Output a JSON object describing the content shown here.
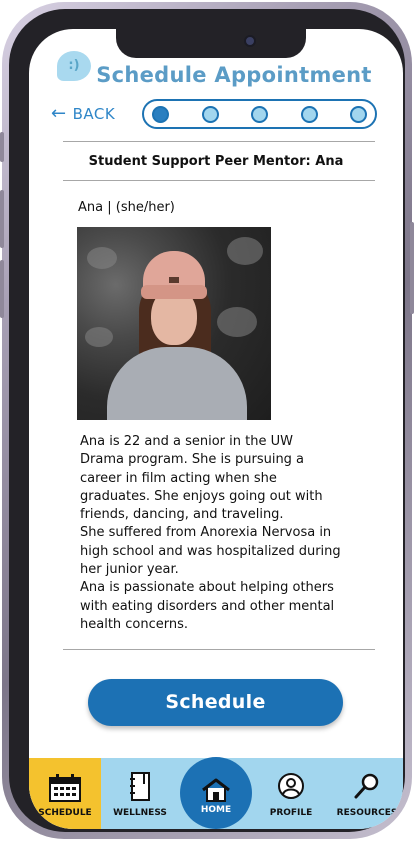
{
  "header": {
    "logo_text": ":)",
    "title": "Schedule Appointment",
    "back_label": "BACK",
    "progress": {
      "steps": 5,
      "current": 1
    }
  },
  "mentor": {
    "heading": "Student Support Peer Mentor: Ana",
    "name_line": "Ana | (she/her)",
    "bio": [
      "Ana is 22 and a senior in the UW",
      "Drama program. She is pursuing a",
      "career in film acting when she",
      "graduates. She enjoys going out with",
      "friends, dancing, and traveling.",
      "She suffered from Anorexia Nervosa in",
      "high school and was hospitalized during",
      "her junior year.",
      "Ana is passionate about helping others",
      "with eating disorders and other mental",
      "health concerns."
    ]
  },
  "actions": {
    "schedule_label": "Schedule"
  },
  "nav": {
    "schedule": "SCHEDULE",
    "wellness": "WELLNESS",
    "home": "HOME",
    "profile": "PROFILE",
    "resources": "RESOURCES"
  },
  "colors": {
    "primary": "#1c71b4",
    "title": "#5b9cc6",
    "nav_bg": "#a2d6ee",
    "active_tab": "#f4c22e"
  }
}
